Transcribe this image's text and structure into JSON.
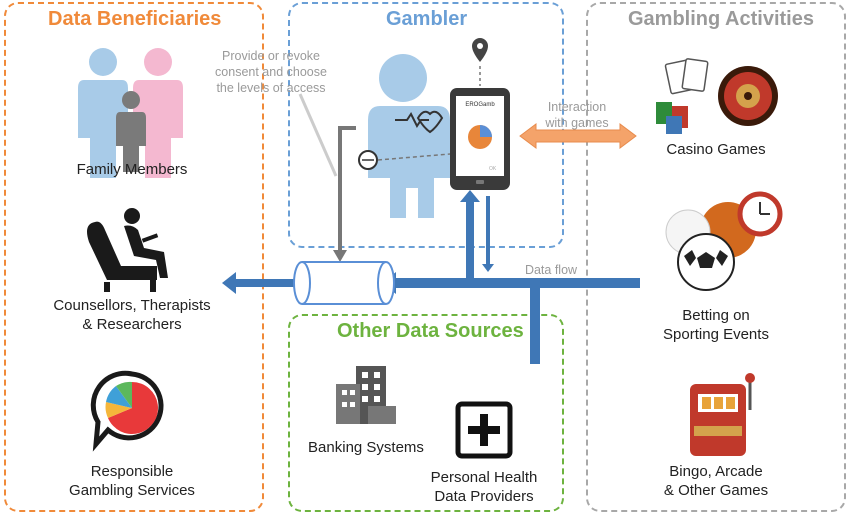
{
  "panels": {
    "beneficiaries": {
      "title": "Data Beneficiaries",
      "color": "#f08a3a"
    },
    "gambler": {
      "title": "Gambler",
      "color": "#6a9fd6"
    },
    "activities": {
      "title": "Gambling Activities",
      "color": "#9a9a9a"
    },
    "sources": {
      "title": "Other Data Sources",
      "color": "#6db33f"
    }
  },
  "beneficiaries": {
    "family": "Family Members",
    "counsellors_1": "Counsellors, Therapists",
    "counsellors_2": "& Researchers",
    "responsible_1": "Responsible",
    "responsible_2": "Gambling Services"
  },
  "gambler": {
    "consent_1": "Provide or revoke",
    "consent_2": "consent and choose",
    "consent_3": "the levels of access",
    "app_name": "EROGamb",
    "app_button": "OK"
  },
  "flows": {
    "interaction_1": "Interaction",
    "interaction_2": "with games",
    "data_flow": "Data flow"
  },
  "activities": {
    "casino": "Casino Games",
    "betting_1": "Betting on",
    "betting_2": "Sporting Events",
    "bingo_1": "Bingo, Arcade",
    "bingo_2": "& Other Games"
  },
  "sources": {
    "banking": "Banking Systems",
    "health_1": "Personal Health",
    "health_2": "Data Providers"
  },
  "icons": {
    "family": "family-icon",
    "counsellor": "therapy-chair-icon",
    "pie": "pie-chart-speech-icon",
    "person": "gambler-person-icon",
    "phone": "smartphone-icon",
    "location": "location-pin-icon",
    "casino": "casino-roulette-icon",
    "sports": "sports-balls-icon",
    "slot": "slot-machine-icon",
    "bank": "bank-building-icon",
    "health": "medical-plus-icon",
    "database": "database-cylinder-icon"
  },
  "colors": {
    "flow": "#3f77b6",
    "interaction": "#f4a36a"
  }
}
